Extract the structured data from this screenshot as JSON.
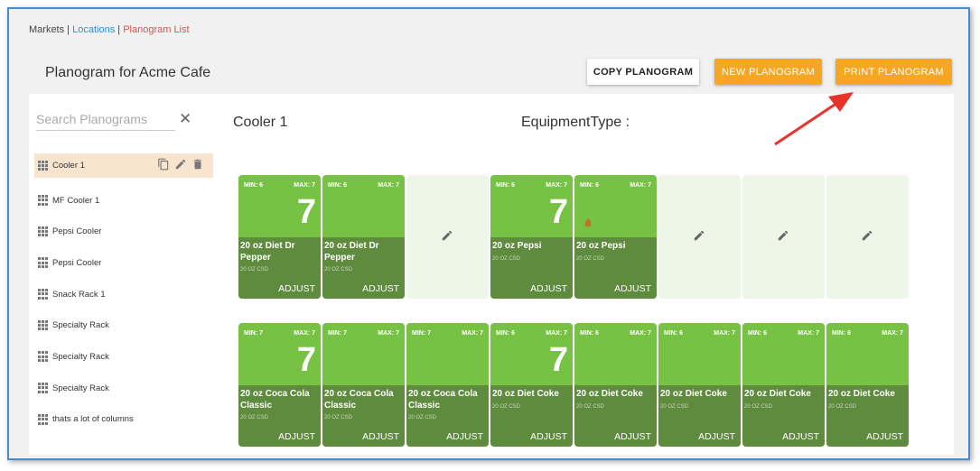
{
  "breadcrumb": {
    "markets": "Markets",
    "sep1": " | ",
    "locations": "Locations",
    "sep2": " | ",
    "current": "Planogram List"
  },
  "page_title": "Planogram for Acme Cafe",
  "buttons": {
    "copy": "COPY PLANOGRAM",
    "new": "NEW PLANOGRAM",
    "print": "PRINT PLANOGRAM"
  },
  "colors": {
    "accent": "#f5a623",
    "link": "#2b8fd6",
    "active_crumb": "#d9534f",
    "slot_top": "#77c244",
    "slot_bottom": "#5e8b3e",
    "slot_empty": "#eef6e8",
    "annotation_arrow": "#e8332a"
  },
  "search": {
    "placeholder": "Search Planograms"
  },
  "sidebar": {
    "items": [
      {
        "label": "Cooler 1"
      },
      {
        "label": "MF Cooler 1"
      },
      {
        "label": "Pepsi Cooler"
      },
      {
        "label": "Pepsi Cooler"
      },
      {
        "label": "Snack Rack 1"
      },
      {
        "label": "Specialty Rack"
      },
      {
        "label": "Specialty Rack"
      },
      {
        "label": "Specialty Rack"
      },
      {
        "label": "thats a lot of columns"
      }
    ]
  },
  "main": {
    "cooler_title": "Cooler 1",
    "equipment_type": "EquipmentType :",
    "rows": [
      [
        {
          "min": "MIN: 6",
          "max": "MAX: 7",
          "qty": "7",
          "name": "20 oz Diet Dr Pepper",
          "cat": "20 OZ CSD",
          "adjust": "ADJUST"
        },
        {
          "min": "MIN: 6",
          "max": "MAX: 7",
          "qty": "",
          "name": "20 oz Diet Dr Pepper",
          "cat": "20 OZ CSD",
          "adjust": "ADJUST"
        },
        {
          "empty": true
        },
        {
          "min": "MIN: 6",
          "max": "MAX: 7",
          "qty": "7",
          "name": "20 oz Pepsi",
          "cat": "20 OZ CSD",
          "adjust": "ADJUST"
        },
        {
          "min": "MIN: 6",
          "max": "MAX: 7",
          "qty": "",
          "name": "20 oz Pepsi",
          "cat": "20 OZ CSD",
          "adjust": "ADJUST",
          "bell": true
        },
        {
          "empty": true
        },
        {
          "empty": true
        },
        {
          "empty": true
        }
      ],
      [
        {
          "min": "MIN: 7",
          "max": "MAX: 7",
          "qty": "7",
          "name": "20 oz Coca Cola Classic",
          "cat": "20 OZ CSD",
          "adjust": "ADJUST"
        },
        {
          "min": "MIN: 7",
          "max": "MAX: 7",
          "qty": "",
          "name": "20 oz Coca Cola Classic",
          "cat": "20 OZ CSD",
          "adjust": "ADJUST"
        },
        {
          "min": "MIN: 7",
          "max": "MAX: 7",
          "qty": "",
          "name": "20 oz Coca Cola Classic",
          "cat": "20 OZ CSD",
          "adjust": "ADJUST"
        },
        {
          "min": "MIN: 6",
          "max": "MAX: 7",
          "qty": "7",
          "name": "20 oz Diet Coke",
          "cat": "20 OZ CSD",
          "adjust": "ADJUST"
        },
        {
          "min": "MIN: 6",
          "max": "MAX: 7",
          "qty": "",
          "name": "20 oz Diet Coke",
          "cat": "20 OZ CSD",
          "adjust": "ADJUST"
        },
        {
          "min": "MIN: 6",
          "max": "MAX: 7",
          "qty": "",
          "name": "20 oz Diet Coke",
          "cat": "20 OZ CSD",
          "adjust": "ADJUST"
        },
        {
          "min": "MIN: 6",
          "max": "MAX: 7",
          "qty": "",
          "name": "20 oz Diet Coke",
          "cat": "20 OZ CSD",
          "adjust": "ADJUST"
        },
        {
          "min": "MIN: 6",
          "max": "MAX: 7",
          "qty": "",
          "name": "20 oz Diet Coke",
          "cat": "20 OZ CSD",
          "adjust": "ADJUST"
        }
      ]
    ]
  }
}
